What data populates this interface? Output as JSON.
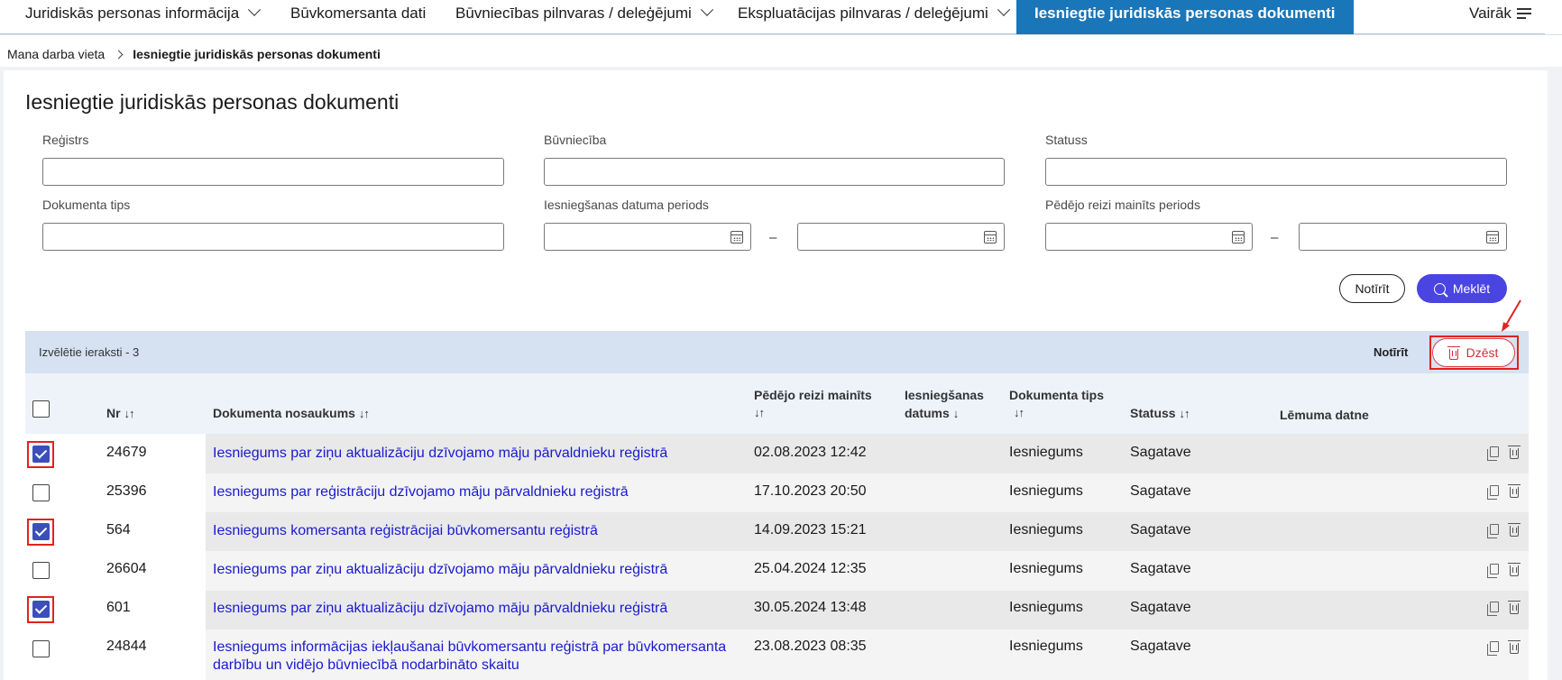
{
  "nav": {
    "items": [
      {
        "label": "Juridiskās personas informācija",
        "dropdown": true
      },
      {
        "label": "Būvkomersanta dati",
        "dropdown": false
      },
      {
        "label": "Būvniecības pilnvaras / deleģējumi",
        "dropdown": true
      },
      {
        "label": "Ekspluatācijas pilnvaras / deleģējumi",
        "dropdown": true
      },
      {
        "label": "Iesniegtie juridiskās personas dokumenti",
        "active": true
      }
    ],
    "more_label": "Vairāk"
  },
  "breadcrumb": {
    "home": "Mana darba vieta",
    "current": "Iesniegtie juridiskās personas dokumenti"
  },
  "page": {
    "title": "Iesniegtie juridiskās personas dokumenti"
  },
  "filters": {
    "registry_label": "Reģistrs",
    "construction_label": "Būvniecība",
    "status_label": "Statuss",
    "doc_type_label": "Dokumenta tips",
    "submit_period_label": "Iesniegšanas datuma periods",
    "changed_period_label": "Pēdējo reizi mainīts periods",
    "range_separator": "–",
    "clear_label": "Notīrīt",
    "search_label": "Meklēt"
  },
  "selection": {
    "text": "Izvēlētie ieraksti - 3",
    "clear_label": "Notīrīt",
    "delete_label": "Dzēst"
  },
  "table": {
    "headers": {
      "nr": "Nr",
      "name": "Dokumenta nosaukums",
      "changed_line1": "Pēdējo reizi mainīts",
      "submitted_line1": "Iesniegšanas",
      "submitted_line2": "datums",
      "doc_type": "Dokumenta tips",
      "status": "Statuss",
      "decision": "Lēmuma datne",
      "sort_both": "↓↑",
      "sort_down": "↓"
    },
    "rows": [
      {
        "checked": true,
        "nr": "24679",
        "name": "Iesniegums par ziņu aktualizāciju dzīvojamo māju pārvaldnieku reģistrā",
        "changed": "02.08.2023 12:42",
        "submitted": "",
        "doc_type": "Iesniegums",
        "status": "Sagatave"
      },
      {
        "checked": false,
        "nr": "25396",
        "name": "Iesniegums par reģistrāciju dzīvojamo māju pārvaldnieku reģistrā",
        "changed": "17.10.2023 20:50",
        "submitted": "",
        "doc_type": "Iesniegums",
        "status": "Sagatave"
      },
      {
        "checked": true,
        "nr": "564",
        "name": "Iesniegums komersanta reģistrācijai būvkomersantu reģistrā",
        "changed": "14.09.2023 15:21",
        "submitted": "",
        "doc_type": "Iesniegums",
        "status": "Sagatave"
      },
      {
        "checked": false,
        "nr": "26604",
        "name": "Iesniegums par ziņu aktualizāciju dzīvojamo māju pārvaldnieku reģistrā",
        "changed": "25.04.2024 12:35",
        "submitted": "",
        "doc_type": "Iesniegums",
        "status": "Sagatave"
      },
      {
        "checked": true,
        "nr": "601",
        "name": "Iesniegums par ziņu aktualizāciju dzīvojamo māju pārvaldnieku reģistrā",
        "changed": "30.05.2024 13:48",
        "submitted": "",
        "doc_type": "Iesniegums",
        "status": "Sagatave"
      },
      {
        "checked": false,
        "nr": "24844",
        "name": "Iesniegums informācijas iekļaušanai būvkomersantu reģistrā par būvkomersanta darbību un vidējo būvniecībā nodarbināto skaitu",
        "changed": "23.08.2023 08:35",
        "submitted": "",
        "doc_type": "Iesniegums",
        "status": "Sagatave"
      }
    ]
  },
  "colors": {
    "nav_active": "#1976b9",
    "primary_button": "#4a44e0",
    "danger": "#d22d3b",
    "highlight_frame": "#e0231e",
    "link": "#1a1ad0"
  }
}
